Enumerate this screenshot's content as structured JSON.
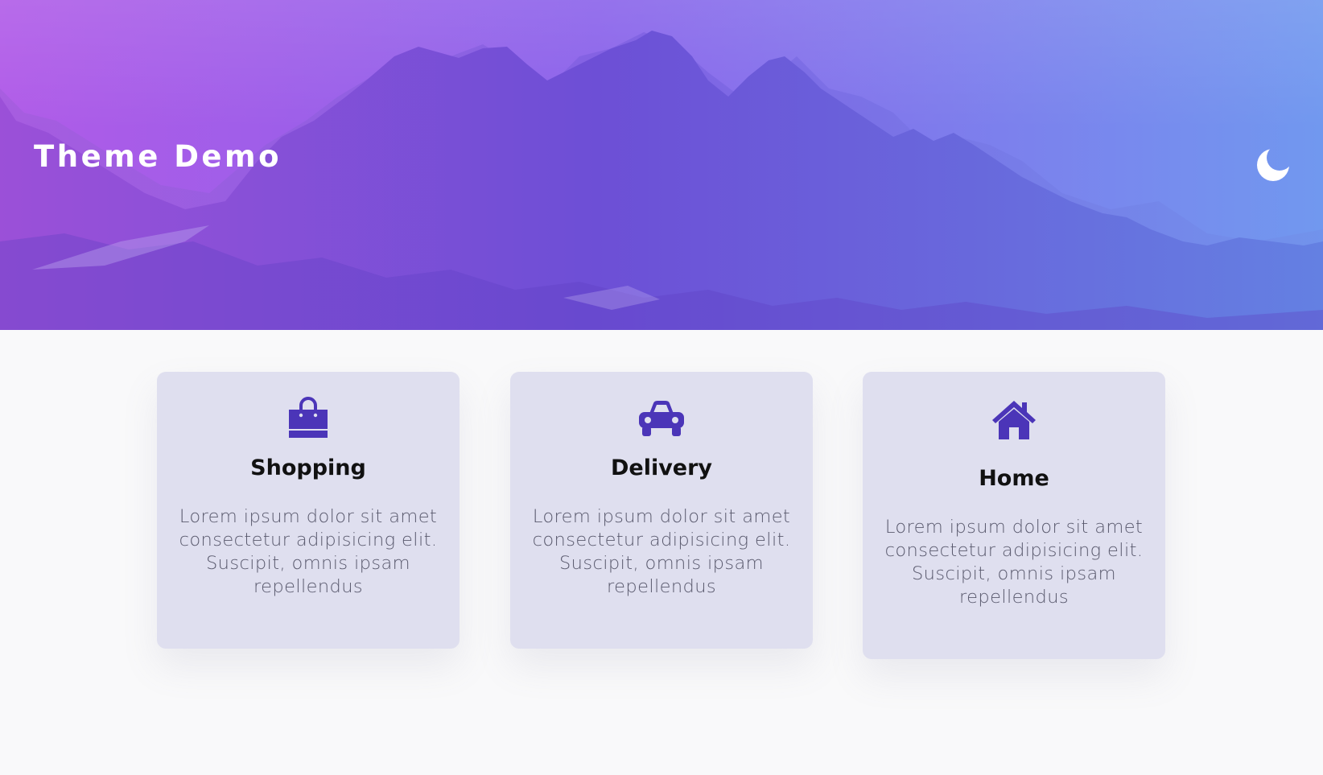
{
  "header": {
    "title": "Theme Demo",
    "toggle_icon": "moon-icon"
  },
  "colors": {
    "gradient_left": "#b05be8",
    "gradient_mid": "#7a5be6",
    "gradient_right": "#7195ee",
    "accent": "#4b35b8",
    "card_background": "#dfdfef",
    "page_background": "#f9f9fa"
  },
  "cards": [
    {
      "icon": "shopping-bag-icon",
      "title": "Shopping",
      "text": "Lorem ipsum dolor sit amet consectetur adipisicing elit. Suscipit, omnis ipsam repellendus"
    },
    {
      "icon": "car-icon",
      "title": "Delivery",
      "text": "Lorem ipsum dolor sit amet consectetur adipisicing elit. Suscipit, omnis ipsam repellendus"
    },
    {
      "icon": "home-icon",
      "title": "Home",
      "text": "Lorem ipsum dolor sit amet consectetur adipisicing elit. Suscipit, omnis ipsam repellendus"
    }
  ]
}
